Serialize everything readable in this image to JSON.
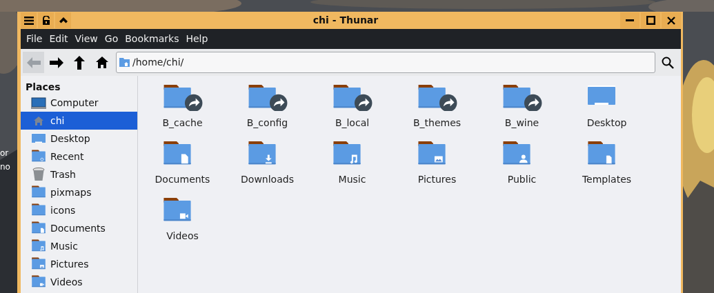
{
  "desktop": {
    "labels": [
      "or",
      "no"
    ]
  },
  "window": {
    "title": "chi - Thunar"
  },
  "menu": [
    "File",
    "Edit",
    "View",
    "Go",
    "Bookmarks",
    "Help"
  ],
  "toolbar": {
    "buttons": [
      {
        "kind": "back",
        "disabled": true
      },
      {
        "kind": "forward",
        "disabled": false
      },
      {
        "kind": "up",
        "disabled": false
      },
      {
        "kind": "home",
        "disabled": false
      }
    ],
    "location": "/home/chi/"
  },
  "sidebar": {
    "heading": "Places",
    "items": [
      {
        "label": "Computer",
        "kind": "computer",
        "selected": false
      },
      {
        "label": "chi",
        "kind": "home",
        "selected": true
      },
      {
        "label": "Desktop",
        "kind": "desktop",
        "selected": false
      },
      {
        "label": "Recent",
        "kind": "recent",
        "selected": false
      },
      {
        "label": "Trash",
        "kind": "trash",
        "selected": false
      },
      {
        "label": "pixmaps",
        "kind": "folder",
        "selected": false
      },
      {
        "label": "icons",
        "kind": "folder",
        "selected": false
      },
      {
        "label": "Documents",
        "kind": "documents",
        "selected": false
      },
      {
        "label": "Music",
        "kind": "music",
        "selected": false
      },
      {
        "label": "Pictures",
        "kind": "pictures",
        "selected": false
      },
      {
        "label": "Videos",
        "kind": "videos",
        "selected": false
      }
    ]
  },
  "files": [
    {
      "name": "B_cache",
      "kind": "link"
    },
    {
      "name": "B_config",
      "kind": "link"
    },
    {
      "name": "B_local",
      "kind": "link"
    },
    {
      "name": "B_themes",
      "kind": "link"
    },
    {
      "name": "B_wine",
      "kind": "link"
    },
    {
      "name": "Desktop",
      "kind": "desktop"
    },
    {
      "name": "Documents",
      "kind": "documents"
    },
    {
      "name": "Downloads",
      "kind": "downloads"
    },
    {
      "name": "Music",
      "kind": "music"
    },
    {
      "name": "Pictures",
      "kind": "pictures"
    },
    {
      "name": "Public",
      "kind": "public"
    },
    {
      "name": "Templates",
      "kind": "templates"
    },
    {
      "name": "Videos",
      "kind": "videos"
    }
  ]
}
